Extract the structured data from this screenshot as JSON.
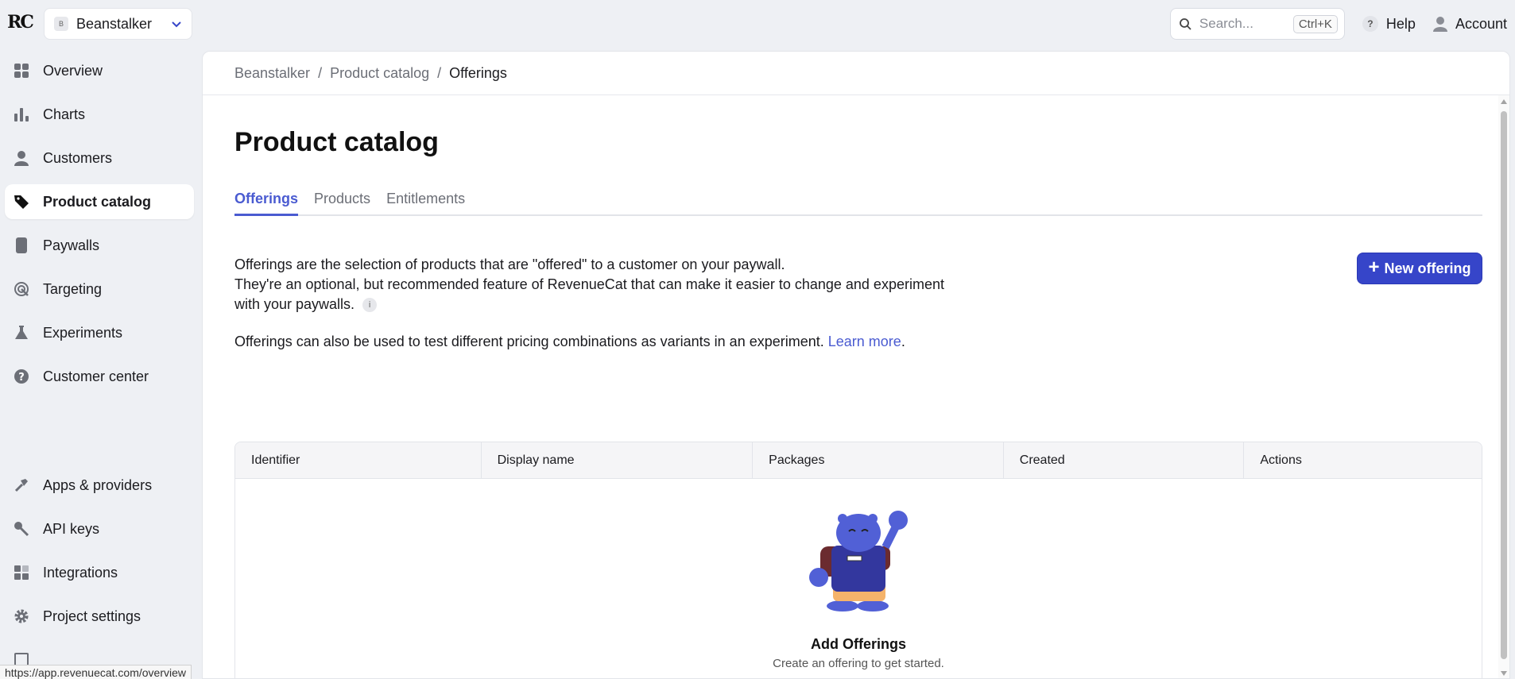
{
  "app": {
    "logo": "RC"
  },
  "project": {
    "badge": "B",
    "name": "Beanstalker"
  },
  "topbar": {
    "search_placeholder": "Search...",
    "shortcut": "Ctrl+K",
    "help": "Help",
    "account": "Account"
  },
  "sidebar": {
    "items": [
      {
        "label": "Overview",
        "icon": "grid-icon"
      },
      {
        "label": "Charts",
        "icon": "bar-chart-icon"
      },
      {
        "label": "Customers",
        "icon": "user-icon"
      },
      {
        "label": "Product catalog",
        "icon": "tag-icon",
        "active": true
      },
      {
        "label": "Paywalls",
        "icon": "phone-icon"
      },
      {
        "label": "Targeting",
        "icon": "target-icon"
      },
      {
        "label": "Experiments",
        "icon": "flask-icon"
      },
      {
        "label": "Customer center",
        "icon": "question-icon"
      },
      {
        "label": "Apps & providers",
        "icon": "hammer-icon"
      },
      {
        "label": "API keys",
        "icon": "key-icon"
      },
      {
        "label": "Integrations",
        "icon": "puzzle-icon"
      },
      {
        "label": "Project settings",
        "icon": "gear-icon"
      }
    ]
  },
  "status_url": "https://app.revenuecat.com/overview",
  "breadcrumb": [
    "Beanstalker",
    "Product catalog",
    "Offerings"
  ],
  "page": {
    "title": "Product catalog",
    "tabs": [
      "Offerings",
      "Products",
      "Entitlements"
    ],
    "desc_line1": "Offerings are the selection of products that are \"offered\" to a customer on your paywall.",
    "desc_line2": "They're an optional, but recommended feature of RevenueCat that can make it easier to change and experiment with your paywalls.",
    "desc2": "Offerings can also be used to test different pricing combinations as variants in an experiment.",
    "learn_more": "Learn more",
    "new_button": "New offering"
  },
  "table": {
    "columns": [
      "Identifier",
      "Display name",
      "Packages",
      "Created",
      "Actions"
    ],
    "empty_title": "Add Offerings",
    "empty_sub": "Create an offering to get started."
  },
  "colors": {
    "accent": "#4a5bd1",
    "button": "#3645c9"
  }
}
